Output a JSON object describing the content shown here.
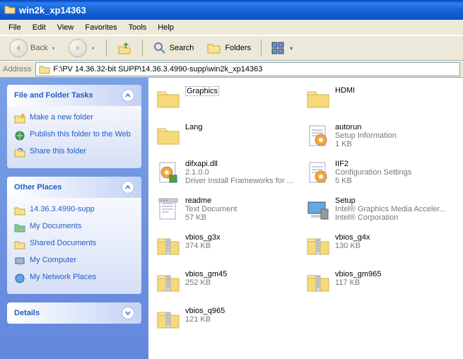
{
  "window": {
    "title": "win2k_xp14363"
  },
  "menus": {
    "file": "File",
    "edit": "Edit",
    "view": "View",
    "favorites": "Favorites",
    "tools": "Tools",
    "help": "Help"
  },
  "toolbar": {
    "back": "Back",
    "search": "Search",
    "folders": "Folders"
  },
  "address": {
    "label": "Address",
    "path": "F:\\PV 14.36.32-bit SUPP\\14.36.3.4990-supp\\win2k_xp14363"
  },
  "sidebar": {
    "panel1": {
      "title": "File and Folder Tasks",
      "tasks": [
        {
          "label": "Make a new folder"
        },
        {
          "label": "Publish this folder to the Web"
        },
        {
          "label": "Share this folder"
        }
      ]
    },
    "panel2": {
      "title": "Other Places",
      "tasks": [
        {
          "label": "14.36.3.4990-supp"
        },
        {
          "label": "My Documents"
        },
        {
          "label": "Shared Documents"
        },
        {
          "label": "My Computer"
        },
        {
          "label": "My Network Places"
        }
      ]
    },
    "panel3": {
      "title": "Details"
    }
  },
  "items": [
    [
      {
        "name": "Graphics",
        "type": "folder",
        "selected": true
      },
      {
        "name": "HDMI",
        "type": "folder"
      }
    ],
    [
      {
        "name": "Lang",
        "type": "folder"
      },
      {
        "name": "autorun",
        "line2": "Setup Information",
        "line3": "1 KB",
        "type": "inf"
      }
    ],
    [
      {
        "name": "difxapi.dll",
        "line2": "2.1.0.0",
        "line3": "Driver Install Frameworks for ...",
        "type": "dll"
      },
      {
        "name": "IIF2",
        "line2": "Configuration Settings",
        "line3": "5 KB",
        "type": "cfg"
      }
    ],
    [
      {
        "name": "readme",
        "line2": "Text Document",
        "line3": "57 KB",
        "type": "txt"
      },
      {
        "name": "Setup",
        "line2": "Intel® Graphics Media Acceler...",
        "line3": "Intel® Corporation",
        "type": "setup"
      }
    ],
    [
      {
        "name": "vbios_g3x",
        "line2": "374 KB",
        "type": "zip"
      },
      {
        "name": "vbios_g4x",
        "line2": "130 KB",
        "type": "zip"
      }
    ],
    [
      {
        "name": "vbios_gm45",
        "line2": "252 KB",
        "type": "zip"
      },
      {
        "name": "vbios_gm965",
        "line2": "117 KB",
        "type": "zip"
      }
    ],
    [
      {
        "name": "vbios_q965",
        "line2": "121 KB",
        "type": "zip"
      }
    ]
  ]
}
